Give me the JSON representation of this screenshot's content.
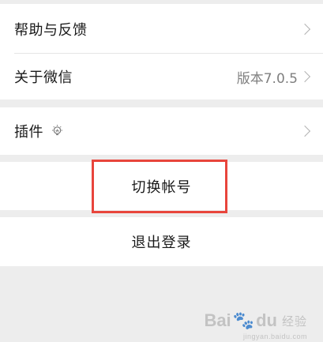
{
  "settings": {
    "items": [
      {
        "label": "帮助与反馈",
        "value": ""
      },
      {
        "label": "关于微信",
        "value": "版本7.0.5"
      },
      {
        "label": "插件",
        "value": ""
      }
    ],
    "switch_account_label": "切换帐号",
    "logout_label": "退出登录"
  },
  "icons": {
    "chevron": "chevron-right-icon",
    "plugin": "lightbulb-icon"
  },
  "colors": {
    "background": "#ededed",
    "cell": "#ffffff",
    "highlight": "#e8453c",
    "secondary_text": "#7f7f7f"
  },
  "watermark": {
    "brand_left": "Bai",
    "brand_right": "du",
    "product": "经验",
    "url": "jingyan.baidu.com"
  }
}
